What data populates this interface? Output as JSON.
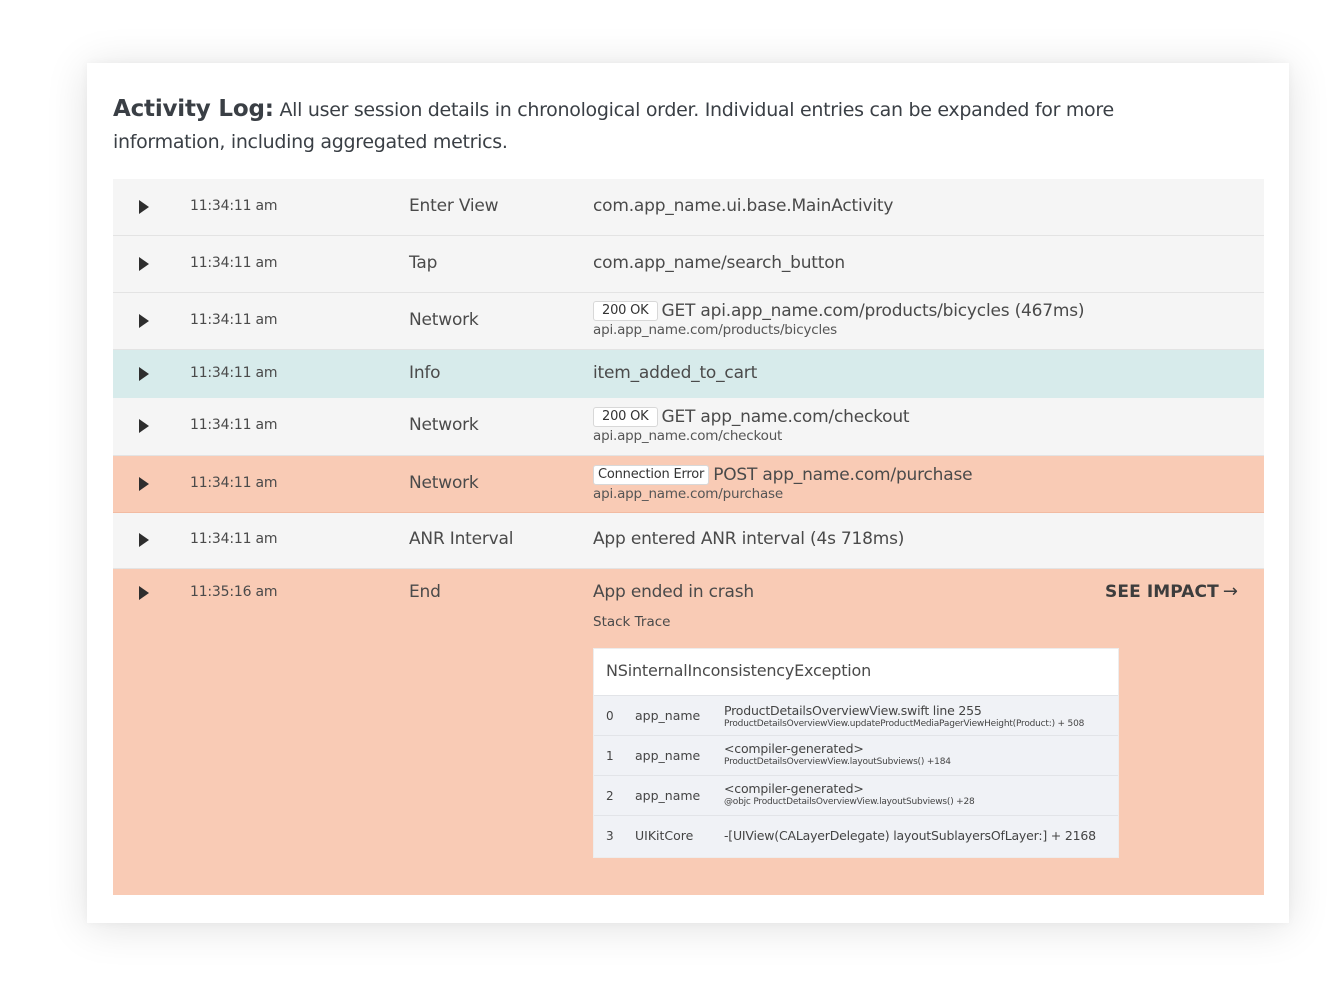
{
  "header": {
    "title": "Activity Log:",
    "description": "All user session details in chronological order. Individual entries can be expanded for more information, including aggregated metrics."
  },
  "colors": {
    "row_default": "#f5f5f5",
    "row_info": "#d7ebeb",
    "row_error": "#f9cbb5"
  },
  "rows": [
    {
      "time": "11:34:11 am",
      "type": "Enter View",
      "main": "com.app_name.ui.base.MainActivity"
    },
    {
      "time": "11:34:11 am",
      "type": "Tap",
      "main": "com.app_name/search_button"
    },
    {
      "time": "11:34:11 am",
      "type": "Network",
      "badge": "200 OK",
      "main": "GET api.app_name.com/products/bicycles (467ms)",
      "sub": "api.app_name.com/products/bicycles"
    },
    {
      "time": "11:34:11 am",
      "type": "Info",
      "main": "item_added_to_cart"
    },
    {
      "time": "11:34:11 am",
      "type": "Network",
      "badge": "200 OK",
      "main": "GET app_name.com/checkout",
      "sub": "api.app_name.com/checkout"
    },
    {
      "time": "11:34:11 am",
      "type": "Network",
      "badge": "Connection Error",
      "main": "POST app_name.com/purchase",
      "sub": "api.app_name.com/purchase"
    },
    {
      "time": "11:34:11 am",
      "type": "ANR Interval",
      "main": "App entered ANR interval (4s 718ms)"
    },
    {
      "time": "11:35:16 am",
      "type": "End",
      "main": "App ended in crash"
    }
  ],
  "crash": {
    "see_impact": "SEE IMPACT",
    "stack_label": "Stack Trace",
    "exception": "NSinternalInconsistencyException",
    "frames": [
      {
        "index": "0",
        "module": "app_name",
        "line1": "ProductDetailsOverviewView.swift line 255",
        "line2": "ProductDetailsOverviewView.updateProductMediaPagerViewHeight(Product:) + 508"
      },
      {
        "index": "1",
        "module": "app_name",
        "line1": "<compiler-generated>",
        "line2": "ProductDetailsOverviewView.layoutSubviews() +184"
      },
      {
        "index": "2",
        "module": "app_name",
        "line1": "<compiler-generated>",
        "line2": "@objc ProductDetailsOverviewView.layoutSubviews() +28"
      },
      {
        "index": "3",
        "module": "UIKitCore",
        "line1": "-[UIView(CALayerDelegate) layoutSublayersOfLayer:] + 2168"
      }
    ]
  },
  "icons": {
    "expand": "play-triangle-icon",
    "arrow": "arrow-right-icon"
  }
}
